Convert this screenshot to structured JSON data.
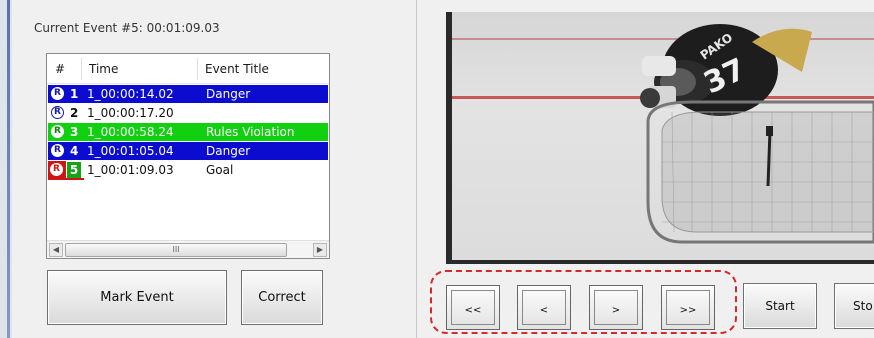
{
  "current_event": "Current Event #5: 00:01:09.03",
  "list": {
    "columns": [
      "#",
      "Time",
      "Event Title"
    ],
    "rows": [
      {
        "num": "1",
        "time": "1_00:00:14.02",
        "title": "Danger",
        "color": "#0b0ccf"
      },
      {
        "num": "2",
        "time": "1_00:00:17.20",
        "title": "",
        "color": "#ffffff"
      },
      {
        "num": "3",
        "time": "1_00:00:58.24",
        "title": "Rules Violation",
        "color": "#10d010"
      },
      {
        "num": "4",
        "time": "1_00:01:05.04",
        "title": "Danger",
        "color": "#0b0ccf"
      },
      {
        "num": "5",
        "time": "1_00:01:09.03",
        "title": "Goal",
        "color": "#ffffff"
      }
    ],
    "badge_glyph": "R",
    "scroll_thumb_glyph": "III"
  },
  "buttons": {
    "mark_event": "Mark Event",
    "correct": "Correct",
    "rewind_fast": "<<",
    "rewind": "<",
    "forward": ">",
    "forward_fast": ">>",
    "start": "Start",
    "stop": "Sto"
  },
  "video": {
    "jersey_text": "PAKO",
    "jersey_number": "37"
  },
  "colors": {
    "highlight_blue": "#0b0ccf",
    "highlight_green": "#10d010",
    "current_red": "#cc1515",
    "nav_group_border": "#d42a2a"
  }
}
